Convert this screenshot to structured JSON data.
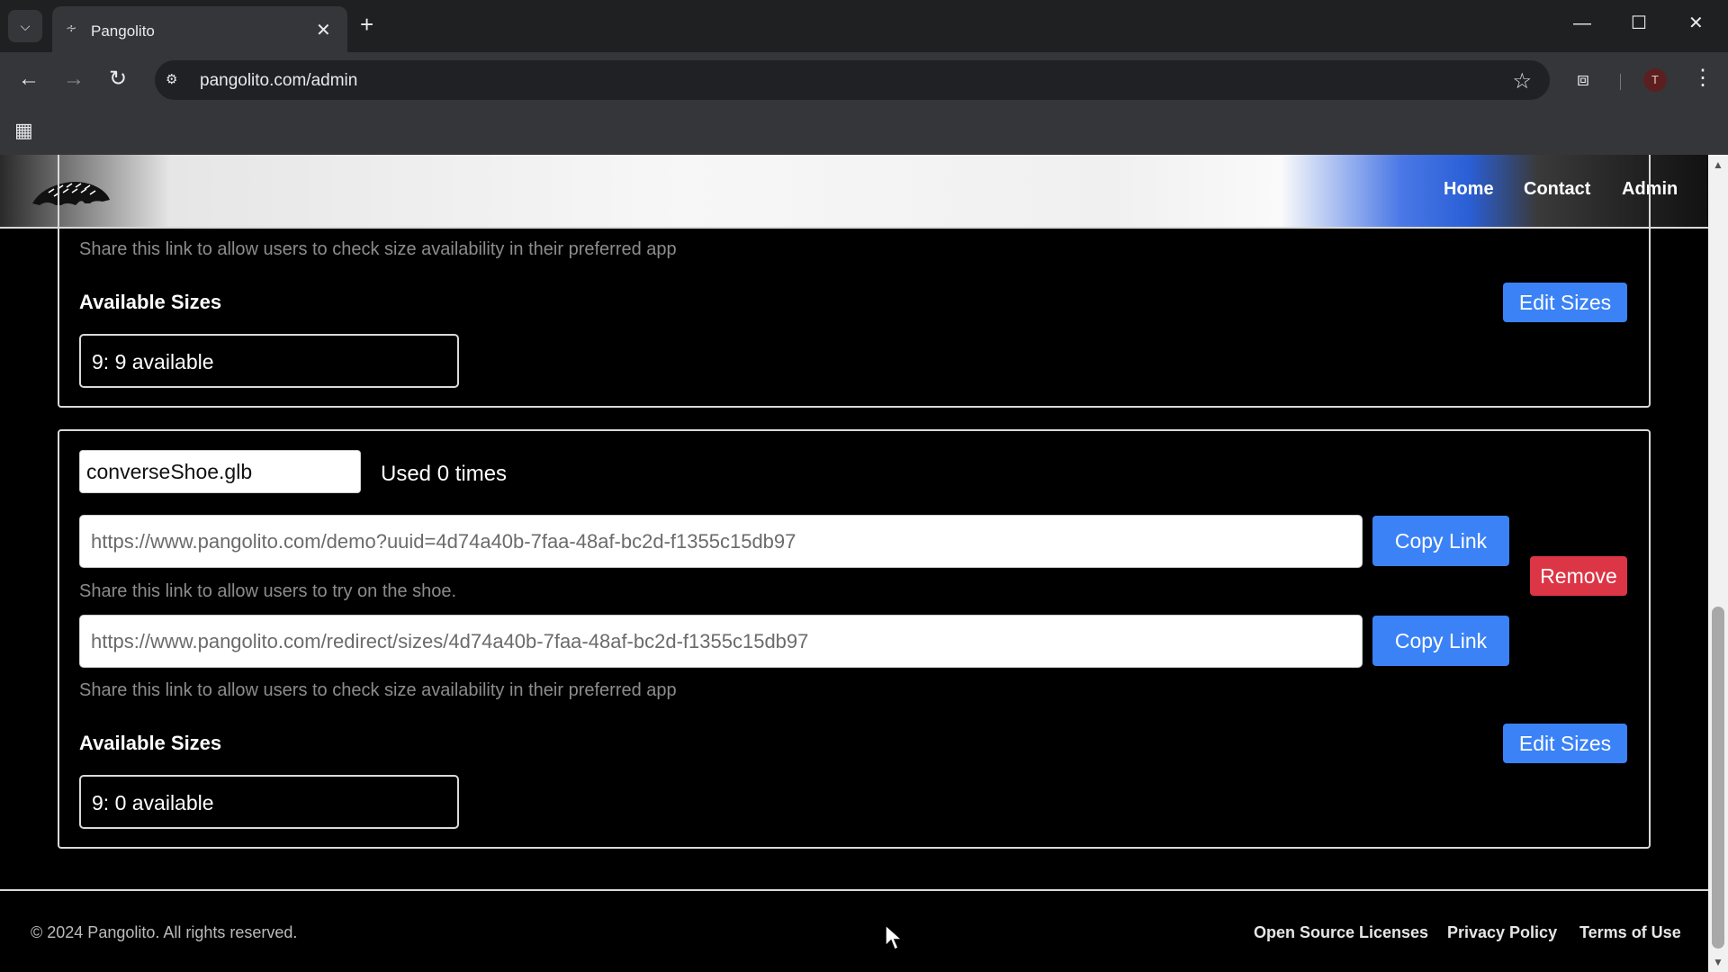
{
  "browser": {
    "tab_title": "Pangolito",
    "url": "pangolito.com/admin",
    "profile_initial": "T"
  },
  "site": {
    "nav": [
      "Home",
      "Contact",
      "Admin"
    ]
  },
  "card1": {
    "size_link_help": "Share this link to allow users to check size availability in their preferred app",
    "sizes_heading": "Available Sizes",
    "edit_sizes_label": "Edit Sizes",
    "sizes": [
      "9:  9 available"
    ]
  },
  "card2": {
    "model_name": "converseShoe.glb",
    "usage": "Used 0 times",
    "demo_url": "https://www.pangolito.com/demo?uuid=4d74a40b-7faa-48af-bc2d-f1355c15db97",
    "copy_label": "Copy Link",
    "demo_help": "Share this link to allow users to try on the shoe.",
    "redirect_url": "https://www.pangolito.com/redirect/sizes/4d74a40b-7faa-48af-bc2d-f1355c15db97",
    "size_link_help": "Share this link to allow users to check size availability in their preferred app",
    "remove_label": "Remove",
    "sizes_heading": "Available Sizes",
    "edit_sizes_label": "Edit Sizes",
    "sizes": [
      "9:  0 available"
    ]
  },
  "footer": {
    "copyright": "© 2024 Pangolito. All rights reserved.",
    "links": [
      "Open Source Licenses",
      "Privacy Policy",
      "Terms of Use"
    ]
  },
  "icons": {
    "tab_search": "chevron-down-icon",
    "back": "back-arrow-icon",
    "forward": "forward-arrow-icon",
    "reload": "reload-icon",
    "bookmark": "star-icon",
    "extensions": "puzzle-icon",
    "menu": "three-dots-icon",
    "apps": "apps-grid-icon"
  },
  "colors": {
    "primary_button": "#3b82f6",
    "danger_button": "#dc3545",
    "page_background": "#000000"
  }
}
